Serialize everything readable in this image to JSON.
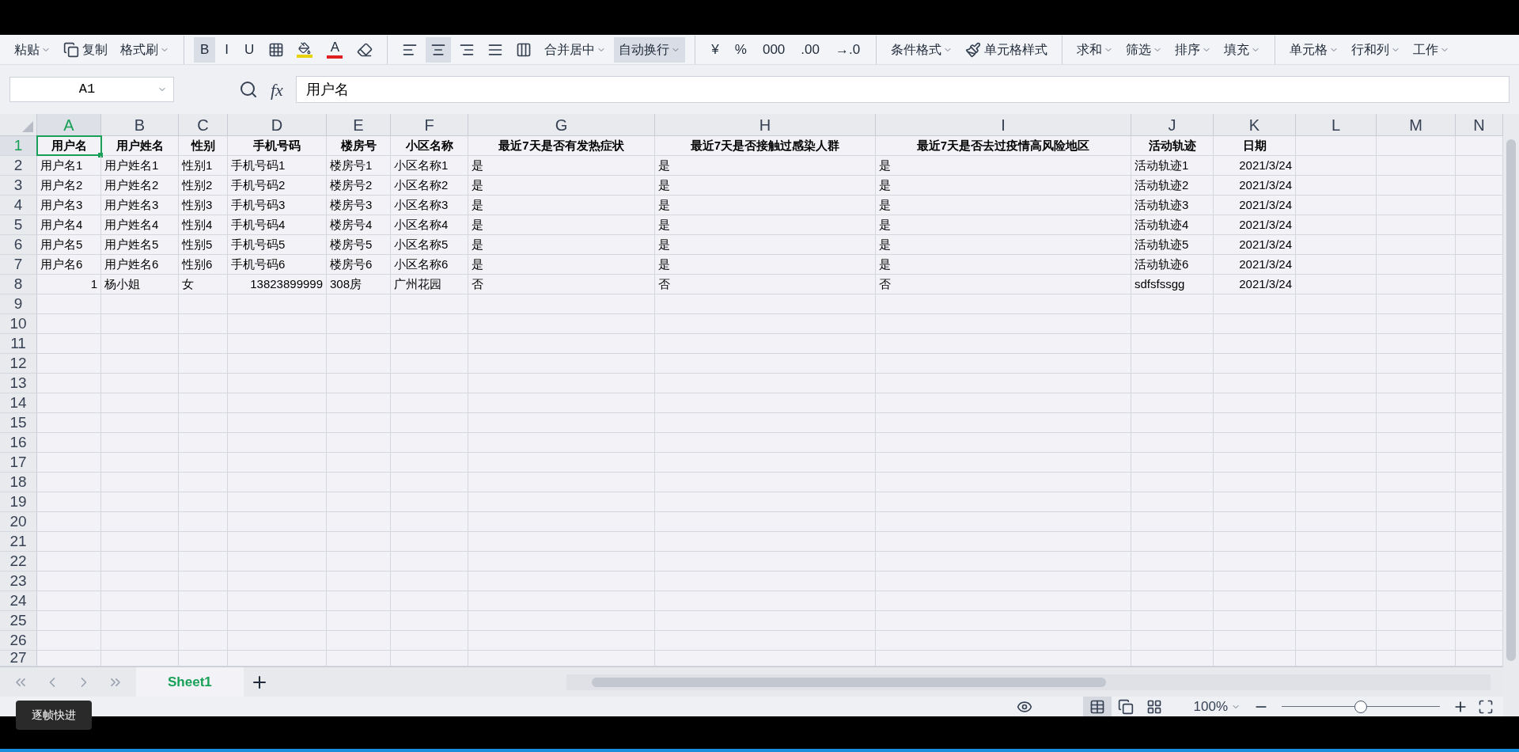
{
  "ribbon": [
    {
      "kind": "text",
      "label": "粘贴"
    },
    {
      "kind": "icon",
      "label": "复制"
    },
    {
      "kind": "text",
      "label": "格式刷"
    },
    {
      "kind": "sep"
    },
    {
      "kind": "glyph",
      "label": "B",
      "selected": true
    },
    {
      "kind": "glyph",
      "label": "I",
      "selected": false
    },
    {
      "kind": "glyph",
      "label": "U",
      "selected": false
    },
    {
      "kind": "icon"
    },
    {
      "kind": "icon",
      "color": "#e8d20a"
    },
    {
      "kind": "glyph-color",
      "label": "A",
      "color": "#e02020"
    },
    {
      "kind": "icon"
    },
    {
      "kind": "sep"
    },
    {
      "kind": "icon",
      "selected": false
    },
    {
      "kind": "icon",
      "selected": true
    },
    {
      "kind": "icon",
      "selected": false
    },
    {
      "kind": "icon",
      "selected": false
    },
    {
      "kind": "icon",
      "selected": false
    },
    {
      "kind": "text",
      "label": "合并居中"
    },
    {
      "kind": "text",
      "label": "自动换行",
      "selected": true
    },
    {
      "kind": "sep"
    },
    {
      "kind": "glyph",
      "label": "¥",
      "selected": false
    },
    {
      "kind": "glyph",
      "label": "%",
      "selected": false
    },
    {
      "kind": "glyph",
      "label": "000",
      "selected": false
    },
    {
      "kind": "glyph",
      "label": ".00",
      "selected": false
    },
    {
      "kind": "glyph",
      "label": "→.0",
      "selected": false
    },
    {
      "kind": "sep"
    },
    {
      "kind": "text",
      "label": "条件格式"
    },
    {
      "kind": "icon",
      "label": "单元格样式"
    },
    {
      "kind": "sep"
    },
    {
      "kind": "text",
      "label": "求和"
    },
    {
      "kind": "text",
      "label": "筛选"
    },
    {
      "kind": "text",
      "label": "排序"
    },
    {
      "kind": "text",
      "label": "填充"
    },
    {
      "kind": "sep"
    },
    {
      "kind": "text",
      "label": "单元格"
    },
    {
      "kind": "text",
      "label": "行和列"
    },
    {
      "kind": "text",
      "label": "工作"
    }
  ],
  "name_box": "A1",
  "formula": "用户名",
  "fx": "fx",
  "columns": [
    {
      "label": "A",
      "selected": true
    },
    {
      "label": "B",
      "selected": false
    },
    {
      "label": "C",
      "selected": false
    },
    {
      "label": "D",
      "selected": false
    },
    {
      "label": "E",
      "selected": false
    },
    {
      "label": "F",
      "selected": false
    },
    {
      "label": "G",
      "selected": false
    },
    {
      "label": "H",
      "selected": false
    },
    {
      "label": "I",
      "selected": false
    },
    {
      "label": "J",
      "selected": false
    },
    {
      "label": "K",
      "selected": false
    },
    {
      "label": "L",
      "selected": false
    },
    {
      "label": "M",
      "selected": false
    },
    {
      "label": "N",
      "selected": false
    }
  ],
  "header_row": {
    "number": "1",
    "selected": true,
    "cells": [
      "用户名",
      "用户姓名",
      "性别",
      "手机号码",
      "楼房号",
      "小区名称",
      "最近7天是否有发热症状",
      "最近7天是否接触过感染人群",
      "最近7天是否去过疫情高风险地区",
      "活动轨迹",
      "日期"
    ]
  },
  "rows": [
    {
      "number": "2",
      "selected": false,
      "cells": [
        {
          "text": "用户名1",
          "kind": "text"
        },
        {
          "text": "用户姓名1",
          "kind": "text"
        },
        {
          "text": "性别1",
          "kind": "text"
        },
        {
          "text": "手机号码1",
          "kind": "text"
        },
        {
          "text": "楼房号1",
          "kind": "text"
        },
        {
          "text": "小区名称1",
          "kind": "text"
        },
        {
          "text": "是",
          "kind": "text"
        },
        {
          "text": "是",
          "kind": "text"
        },
        {
          "text": "是",
          "kind": "text"
        },
        {
          "text": "活动轨迹1",
          "kind": "text"
        },
        {
          "text": "2021/3/24",
          "kind": "number"
        }
      ]
    },
    {
      "number": "3",
      "selected": false,
      "cells": [
        {
          "text": "用户名2",
          "kind": "text"
        },
        {
          "text": "用户姓名2",
          "kind": "text"
        },
        {
          "text": "性别2",
          "kind": "text"
        },
        {
          "text": "手机号码2",
          "kind": "text"
        },
        {
          "text": "楼房号2",
          "kind": "text"
        },
        {
          "text": "小区名称2",
          "kind": "text"
        },
        {
          "text": "是",
          "kind": "text"
        },
        {
          "text": "是",
          "kind": "text"
        },
        {
          "text": "是",
          "kind": "text"
        },
        {
          "text": "活动轨迹2",
          "kind": "text"
        },
        {
          "text": "2021/3/24",
          "kind": "number"
        }
      ]
    },
    {
      "number": "4",
      "selected": false,
      "cells": [
        {
          "text": "用户名3",
          "kind": "text"
        },
        {
          "text": "用户姓名3",
          "kind": "text"
        },
        {
          "text": "性别3",
          "kind": "text"
        },
        {
          "text": "手机号码3",
          "kind": "text"
        },
        {
          "text": "楼房号3",
          "kind": "text"
        },
        {
          "text": "小区名称3",
          "kind": "text"
        },
        {
          "text": "是",
          "kind": "text"
        },
        {
          "text": "是",
          "kind": "text"
        },
        {
          "text": "是",
          "kind": "text"
        },
        {
          "text": "活动轨迹3",
          "kind": "text"
        },
        {
          "text": "2021/3/24",
          "kind": "number"
        }
      ]
    },
    {
      "number": "5",
      "selected": false,
      "cells": [
        {
          "text": "用户名4",
          "kind": "text"
        },
        {
          "text": "用户姓名4",
          "kind": "text"
        },
        {
          "text": "性别4",
          "kind": "text"
        },
        {
          "text": "手机号码4",
          "kind": "text"
        },
        {
          "text": "楼房号4",
          "kind": "text"
        },
        {
          "text": "小区名称4",
          "kind": "text"
        },
        {
          "text": "是",
          "kind": "text"
        },
        {
          "text": "是",
          "kind": "text"
        },
        {
          "text": "是",
          "kind": "text"
        },
        {
          "text": "活动轨迹4",
          "kind": "text"
        },
        {
          "text": "2021/3/24",
          "kind": "number"
        }
      ]
    },
    {
      "number": "6",
      "selected": false,
      "cells": [
        {
          "text": "用户名5",
          "kind": "text"
        },
        {
          "text": "用户姓名5",
          "kind": "text"
        },
        {
          "text": "性别5",
          "kind": "text"
        },
        {
          "text": "手机号码5",
          "kind": "text"
        },
        {
          "text": "楼房号5",
          "kind": "text"
        },
        {
          "text": "小区名称5",
          "kind": "text"
        },
        {
          "text": "是",
          "kind": "text"
        },
        {
          "text": "是",
          "kind": "text"
        },
        {
          "text": "是",
          "kind": "text"
        },
        {
          "text": "活动轨迹5",
          "kind": "text"
        },
        {
          "text": "2021/3/24",
          "kind": "number"
        }
      ]
    },
    {
      "number": "7",
      "selected": false,
      "cells": [
        {
          "text": "用户名6",
          "kind": "text"
        },
        {
          "text": "用户姓名6",
          "kind": "text"
        },
        {
          "text": "性别6",
          "kind": "text"
        },
        {
          "text": "手机号码6",
          "kind": "text"
        },
        {
          "text": "楼房号6",
          "kind": "text"
        },
        {
          "text": "小区名称6",
          "kind": "text"
        },
        {
          "text": "是",
          "kind": "text"
        },
        {
          "text": "是",
          "kind": "text"
        },
        {
          "text": "是",
          "kind": "text"
        },
        {
          "text": "活动轨迹6",
          "kind": "text"
        },
        {
          "text": "2021/3/24",
          "kind": "number"
        }
      ]
    },
    {
      "number": "8",
      "selected": false,
      "cells": [
        {
          "text": "1",
          "kind": "number"
        },
        {
          "text": "杨小姐",
          "kind": "text"
        },
        {
          "text": "女",
          "kind": "text"
        },
        {
          "text": "13823899999",
          "kind": "number"
        },
        {
          "text": "308房",
          "kind": "text"
        },
        {
          "text": "广州花园",
          "kind": "text"
        },
        {
          "text": "否",
          "kind": "text"
        },
        {
          "text": "否",
          "kind": "text"
        },
        {
          "text": "否",
          "kind": "text"
        },
        {
          "text": "sdfsfssgg",
          "kind": "text"
        },
        {
          "text": "2021/3/24",
          "kind": "number"
        }
      ]
    },
    {
      "number": "9",
      "selected": false,
      "cells": []
    },
    {
      "number": "10",
      "selected": false,
      "cells": []
    },
    {
      "number": "11",
      "selected": false,
      "cells": []
    },
    {
      "number": "12",
      "selected": false,
      "cells": []
    },
    {
      "number": "13",
      "selected": false,
      "cells": []
    },
    {
      "number": "14",
      "selected": false,
      "cells": []
    },
    {
      "number": "15",
      "selected": false,
      "cells": []
    },
    {
      "number": "16",
      "selected": false,
      "cells": []
    },
    {
      "number": "17",
      "selected": false,
      "cells": []
    },
    {
      "number": "18",
      "selected": false,
      "cells": []
    },
    {
      "number": "19",
      "selected": false,
      "cells": []
    },
    {
      "number": "20",
      "selected": false,
      "cells": []
    },
    {
      "number": "21",
      "selected": false,
      "cells": []
    },
    {
      "number": "22",
      "selected": false,
      "cells": []
    },
    {
      "number": "23",
      "selected": false,
      "cells": []
    },
    {
      "number": "24",
      "selected": false,
      "cells": []
    },
    {
      "number": "25",
      "selected": false,
      "cells": []
    },
    {
      "number": "26",
      "selected": false,
      "cells": []
    },
    {
      "number": "27",
      "selected": false,
      "cells": []
    }
  ],
  "sheet_tabs": [
    {
      "label": "Sheet1",
      "selected": true
    }
  ],
  "status_bar": {
    "zoom": "100%",
    "zoom_slider": {
      "level": 0.5
    },
    "views": [
      {
        "selected": true
      },
      {
        "selected": false
      },
      {
        "selected": false
      }
    ]
  },
  "tooltip": "逐帧快进"
}
